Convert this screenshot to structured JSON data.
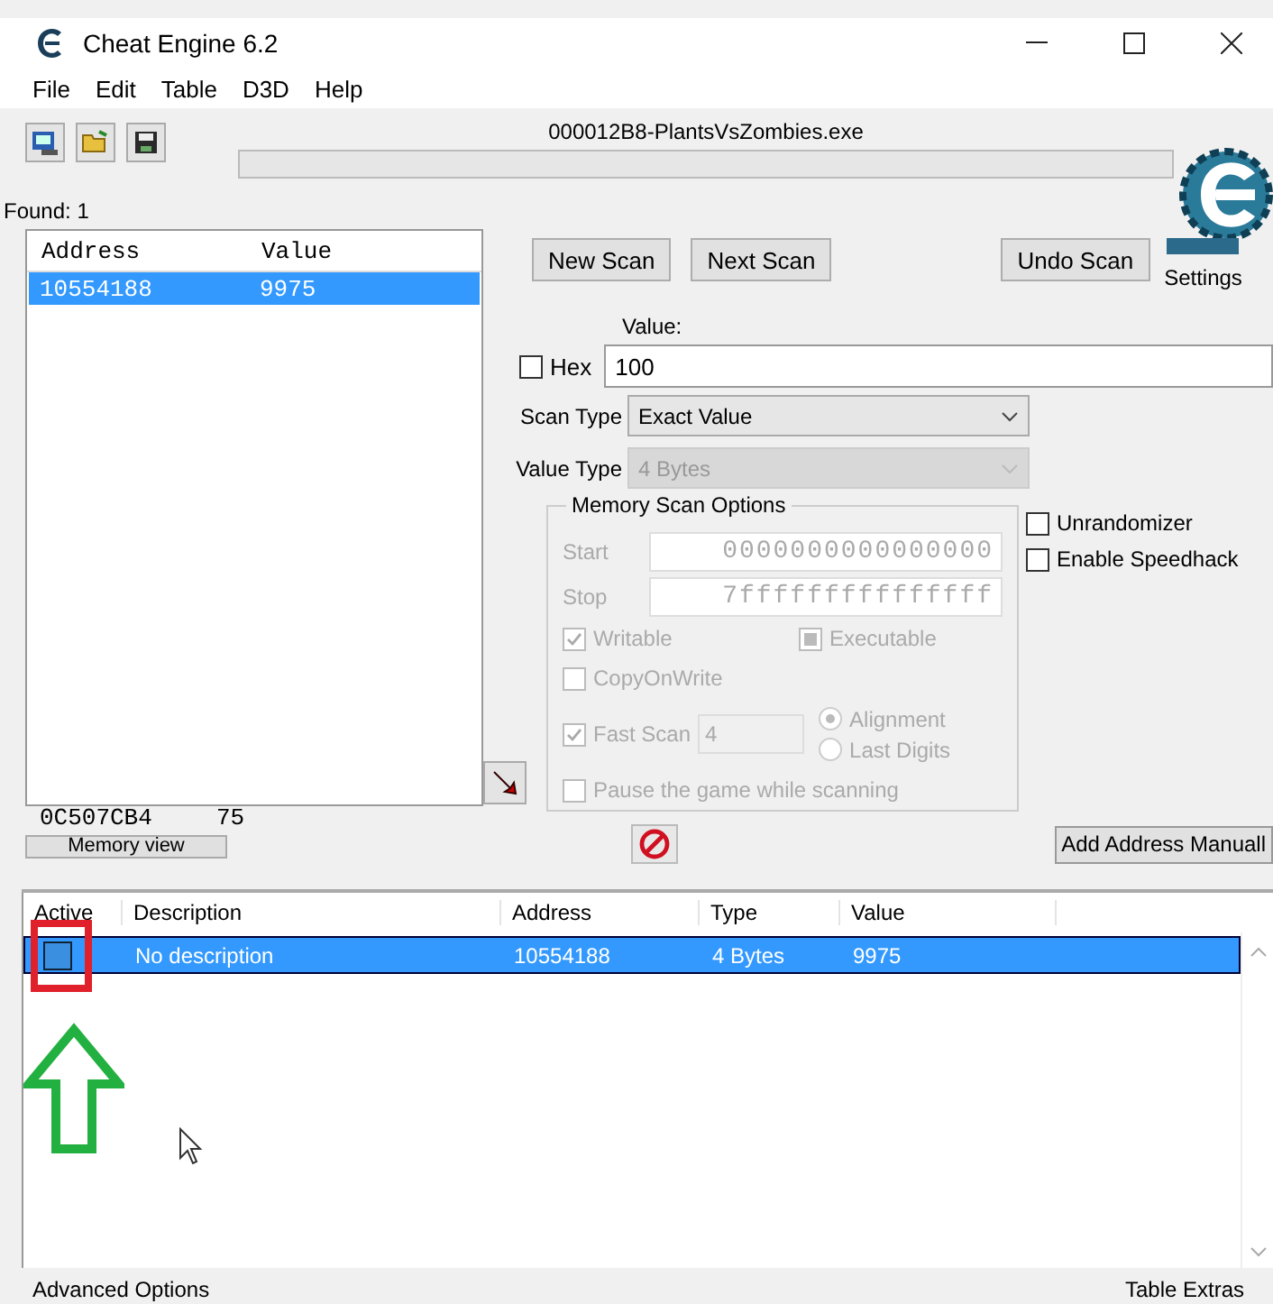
{
  "window": {
    "title": "Cheat Engine 6.2"
  },
  "menu": [
    "File",
    "Edit",
    "Table",
    "D3D",
    "Help"
  ],
  "process": "000012B8-PlantsVsZombies.exe",
  "scan_progress": {
    "level": 0
  },
  "found": "Found: 1",
  "results": {
    "columns": [
      "Address",
      "Value"
    ],
    "rows": [
      {
        "address": "10554188",
        "value": "9975",
        "selected": true
      }
    ]
  },
  "pointer_readout": {
    "address": "0C507CB4",
    "value": "75"
  },
  "memory_view_button": "Memory view",
  "scan_buttons": [
    "New Scan",
    "Next Scan",
    "Undo Scan"
  ],
  "settings_label": "Settings",
  "value": {
    "label": "Value:",
    "hex": {
      "label": "Hex",
      "checked": false
    },
    "input": "100"
  },
  "scan_type": {
    "label": "Scan Type",
    "value": "Exact Value",
    "disabled": false
  },
  "value_type": {
    "label": "Value Type",
    "value": "4 Bytes",
    "disabled": true
  },
  "memory_options": {
    "title": "Memory Scan Options",
    "disabled": true,
    "start_label": "Start",
    "start": "0000000000000000",
    "stop_label": "Stop",
    "stop": "7fffffffffffffff",
    "writable": {
      "label": "Writable",
      "checked": true
    },
    "executable": {
      "label": "Executable",
      "checked": false,
      "indeterminate": true
    },
    "copy_on_write": {
      "label": "CopyOnWrite",
      "checked": false
    },
    "fast_scan": {
      "label": "Fast Scan",
      "checked": true,
      "value": "4"
    },
    "alignment": [
      {
        "label": "Alignment",
        "selected": true
      },
      {
        "label": "Last Digits",
        "selected": false
      }
    ],
    "pause": {
      "label": "Pause the game while scanning",
      "checked": false
    }
  },
  "options": [
    {
      "label": "Unrandomizer",
      "checked": false
    },
    {
      "label": "Enable Speedhack",
      "checked": false
    }
  ],
  "add_address_button": "Add Address Manuall",
  "address_table": {
    "columns": [
      "Active",
      "Description",
      "Address",
      "Type",
      "Value"
    ],
    "rows": [
      {
        "active": false,
        "description": "No description",
        "address": "10554188",
        "type": "4 Bytes",
        "value": "9975",
        "selected": true
      }
    ]
  },
  "status_bar": {
    "left": "Advanced Options",
    "right": "Table Extras"
  }
}
